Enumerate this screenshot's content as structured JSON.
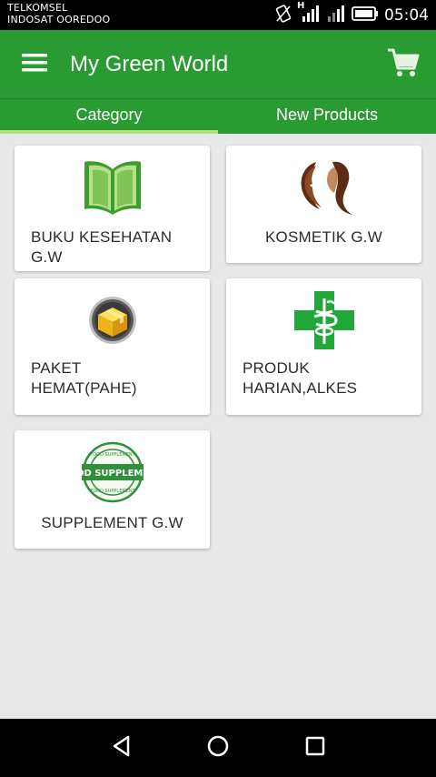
{
  "status_bar": {
    "carrier_1": "TELKOMSEL",
    "carrier_2": "INDOSAT OOREDOO",
    "time": "05:04",
    "network_label": "H"
  },
  "app_bar": {
    "title": "My Green World",
    "menu_icon": "hamburger-menu-icon",
    "cart_icon": "shopping-cart-icon"
  },
  "tabs": [
    {
      "label": "Category",
      "selected": true
    },
    {
      "label": "New Products",
      "selected": false
    }
  ],
  "categories": [
    {
      "label": "BUKU KESEHATAN G.W",
      "icon": "green-book-icon"
    },
    {
      "label": "KOSMETIK G.W",
      "icon": "woman-silhouette-icon"
    },
    {
      "label": "PAKET HEMAT(PAHE)",
      "icon": "gold-package-icon"
    },
    {
      "label": "PRODUK HARIAN,ALKES",
      "icon": "green-pharmacy-cross-icon"
    },
    {
      "label": "SUPPLEMENT G.W",
      "icon": "food-supplement-stamp-icon",
      "stamp_text": "OOD SUPPLEMEN",
      "stamp_ring_text": "FOOD SUPPLEMENT"
    }
  ],
  "nav_bar": {
    "back_icon": "back-triangle-icon",
    "home_icon": "home-circle-icon",
    "recents_icon": "recents-square-icon"
  },
  "colors": {
    "primary": "#2a9b33",
    "tab_indicator": "#aee07b",
    "background": "#e8e8e8"
  }
}
